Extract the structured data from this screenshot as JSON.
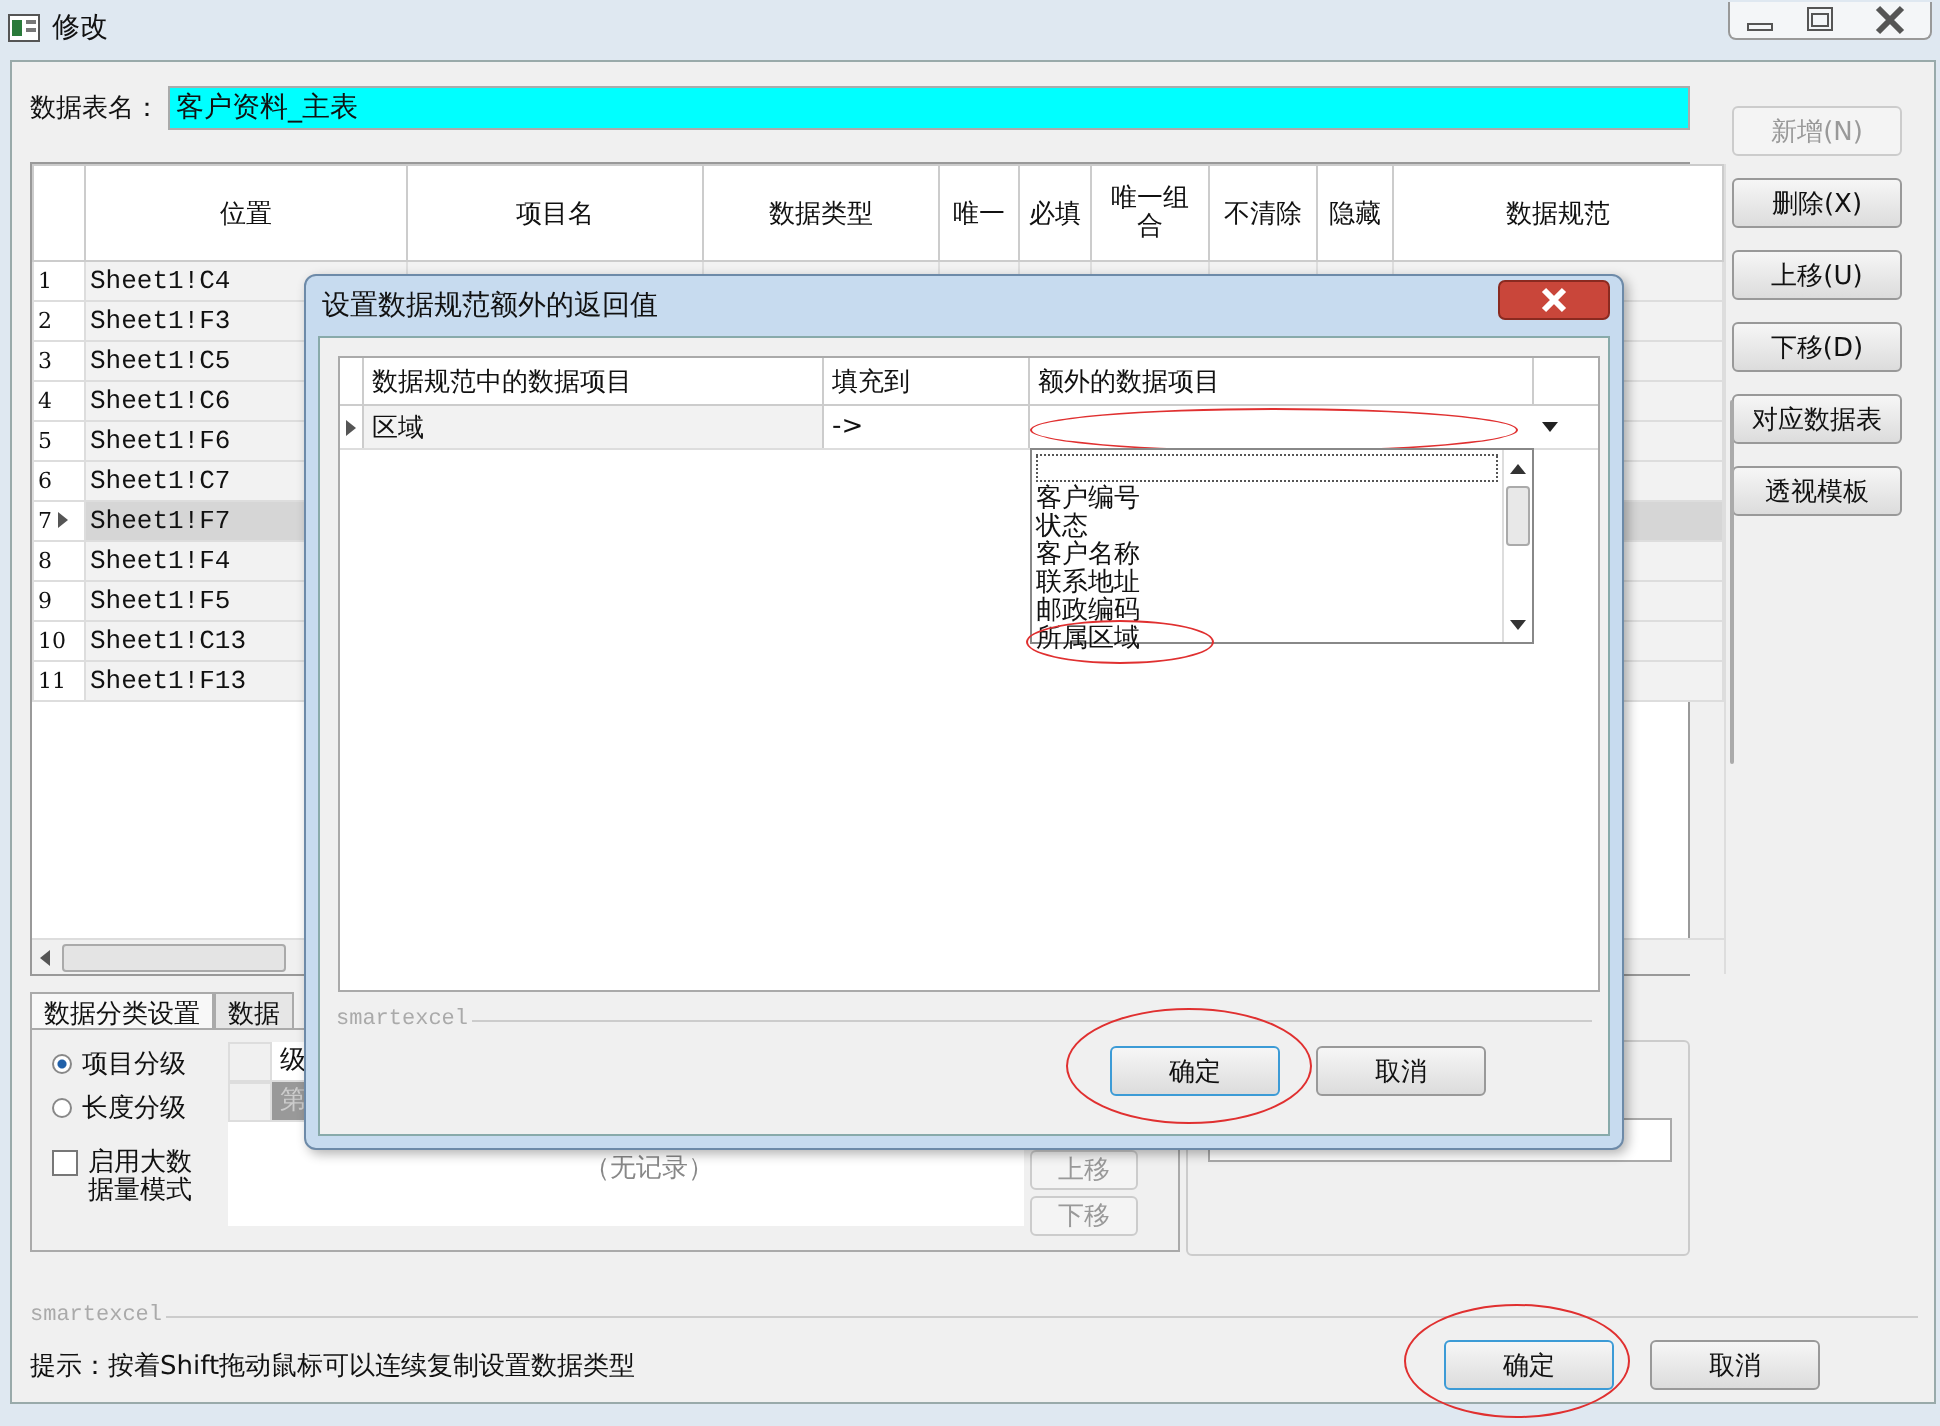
{
  "window": {
    "title": "修改"
  },
  "table_name": {
    "label": "数据表名：",
    "value": "客户资料_主表"
  },
  "side_buttons": [
    {
      "label": "新增(N)",
      "disabled": true
    },
    {
      "label": "删除(X)",
      "disabled": false
    },
    {
      "label": "上移(U)",
      "disabled": false
    },
    {
      "label": "下移(D)",
      "disabled": false
    },
    {
      "label": "对应数据表",
      "disabled": false
    },
    {
      "label": "透视模板",
      "disabled": false
    }
  ],
  "grid": {
    "columns": [
      "位置",
      "项目名",
      "数据类型",
      "唯一",
      "必填",
      "唯一组合",
      "不清除",
      "隐藏",
      "数据规范"
    ],
    "rows": [
      {
        "num": "1",
        "position": "Sheet1!C4",
        "selected": false
      },
      {
        "num": "2",
        "position": "Sheet1!F3",
        "selected": false
      },
      {
        "num": "3",
        "position": "Sheet1!C5",
        "selected": false
      },
      {
        "num": "4",
        "position": "Sheet1!C6",
        "selected": false
      },
      {
        "num": "5",
        "position": "Sheet1!F6",
        "selected": false
      },
      {
        "num": "6",
        "position": "Sheet1!C7",
        "selected": false
      },
      {
        "num": "7",
        "position": "Sheet1!F7",
        "selected": true
      },
      {
        "num": "8",
        "position": "Sheet1!F4",
        "selected": false
      },
      {
        "num": "9",
        "position": "Sheet1!F5",
        "selected": false
      },
      {
        "num": "10",
        "position": "Sheet1!C13",
        "selected": false
      },
      {
        "num": "11",
        "position": "Sheet1!F13",
        "selected": false
      }
    ]
  },
  "bottom_tabs": [
    {
      "label": "数据分类设置",
      "selected": true
    },
    {
      "label": "数据",
      "selected": false
    }
  ],
  "classification": {
    "options": [
      {
        "label": "项目分级",
        "selected": true
      },
      {
        "label": "长度分级",
        "selected": false
      }
    ],
    "big_data": {
      "label": "启用大数据量模式",
      "checked": false
    },
    "levels": {
      "column": "级",
      "row": "第",
      "empty_text": "（无记录）"
    },
    "buttons": [
      {
        "label": "上移",
        "disabled": true
      },
      {
        "label": "下移",
        "disabled": true
      }
    ]
  },
  "footer": {
    "brand": "smartexcel",
    "hint": "提示：按着Shift拖动鼠标可以连续复制设置数据类型",
    "buttons": [
      {
        "label": "确定",
        "default": true,
        "circled": true
      },
      {
        "label": "取消",
        "default": false,
        "circled": false
      }
    ]
  },
  "dialog": {
    "title": "设置数据规范额外的返回值",
    "columns": [
      "数据规范中的数据项目",
      "填充到",
      "额外的数据项目"
    ],
    "rows": [
      {
        "source": "区域",
        "arrow": "->",
        "circled": true
      }
    ],
    "dropdown": [
      {
        "label": "客户编号",
        "circled": false
      },
      {
        "label": "状态",
        "circled": false
      },
      {
        "label": "客户名称",
        "circled": false
      },
      {
        "label": "联系地址",
        "circled": false
      },
      {
        "label": "邮政编码",
        "circled": false
      },
      {
        "label": "所属区域",
        "circled": true
      }
    ],
    "brand": "smartexcel",
    "buttons": [
      {
        "label": "确定",
        "default": true,
        "circled": true
      },
      {
        "label": "取消",
        "default": false,
        "circled": false
      }
    ]
  }
}
